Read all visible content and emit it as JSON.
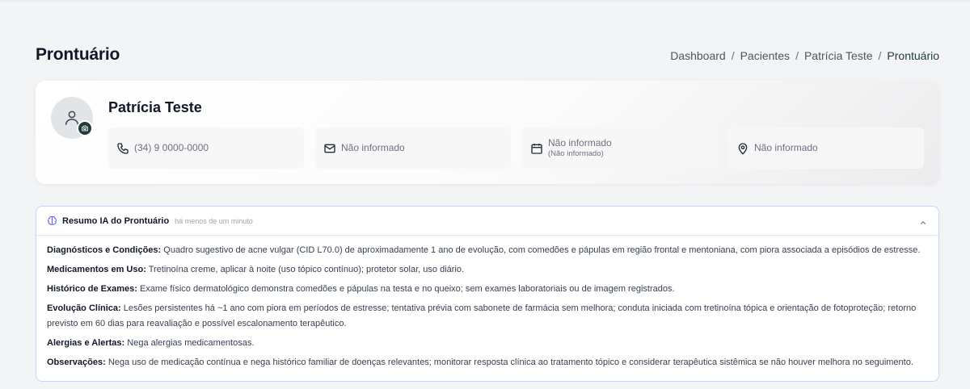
{
  "page": {
    "title": "Prontuário",
    "breadcrumb": [
      "Dashboard",
      "Pacientes",
      "Patrícia Teste",
      "Prontuário"
    ],
    "breadcrumb_separator": "/"
  },
  "patient": {
    "name": "Patrícia Teste",
    "phone": "(34) 9 0000-0000",
    "email": "Não informado",
    "birth": "Não informado",
    "birth_sub": "(Não informado)",
    "address": "Não informado",
    "icons": [
      "user-icon",
      "camera-icon",
      "phone-icon",
      "mail-icon",
      "calendar-icon",
      "map-pin-icon"
    ]
  },
  "ai_summary": {
    "title": "Resumo IA do Prontuário",
    "timestamp": "há menos de um minuto",
    "icons": [
      "brain-icon",
      "chevron-up-icon"
    ],
    "sections": [
      {
        "label": "Diagnósticos e Condições:",
        "text": "Quadro sugestivo de acne vulgar (CID L70.0) de aproximadamente 1 ano de evolução, com comedões e pápulas em região frontal e mentoniana, com piora associada a episódios de estresse."
      },
      {
        "label": "Medicamentos em Uso:",
        "text": "Tretinoína creme, aplicar à noite (uso tópico contínuo); protetor solar, uso diário."
      },
      {
        "label": "Histórico de Exames:",
        "text": "Exame físico dermatológico demonstra comedões e pápulas na testa e no queixo; sem exames laboratoriais ou de imagem registrados."
      },
      {
        "label": "Evolução Clínica:",
        "text": "Lesões persistentes há ~1 ano com piora em períodos de estresse; tentativa prévia com sabonete de farmácia sem melhora; conduta iniciada com tretinoína tópica e orientação de fotoproteção; retorno previsto em 60 dias para reavaliação e possível escalonamento terapêutico."
      },
      {
        "label": "Alergias e Alertas:",
        "text": "Nega alergias medicamentosas."
      },
      {
        "label": "Observações:",
        "text": "Nega uso de medicação contínua e nega histórico familiar de doenças relevantes; monitorar resposta clínica ao tratamento tópico e considerar terapêutica sistêmica se não houver melhora no seguimento."
      }
    ]
  },
  "colors": {
    "accent": "#1f3b3a",
    "ai_border": "#c7d2fe",
    "brain_icon": "#6366f1"
  }
}
